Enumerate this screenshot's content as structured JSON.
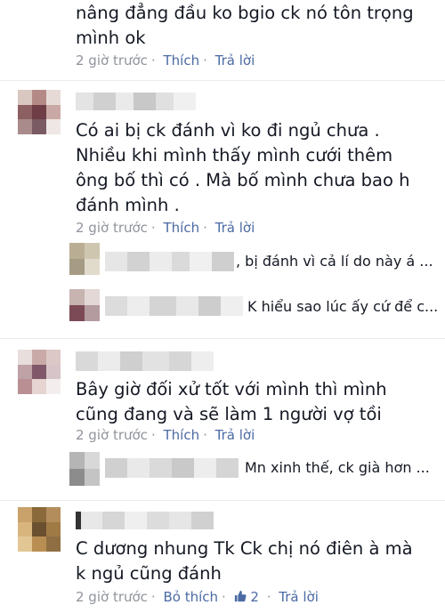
{
  "comments": [
    {
      "text": "nâng đẳng đầu ko bgio ck nó tôn trọng\nmình ok",
      "time": "2 giờ trước",
      "like": "Thích",
      "reply": "Trả lời"
    },
    {
      "text": "Có ai bị ck đánh vì ko đi ngủ chưa .\nNhiều khi mình thấy mình cưới thêm\nông bố thì có . Mà bố mình chưa bao h\nđánh mình .",
      "time": "2 giờ trước",
      "like": "Thích",
      "reply": "Trả lời",
      "replies": [
        {
          "text": ", bị đánh vì cả lí do này á ..."
        },
        {
          "text": "K hiểu sao lúc ấy cứ để c..."
        }
      ]
    },
    {
      "text": "Bây giờ đối xử tốt với mình thì mình\ncũng đang và sẽ làm 1 người vợ tồi",
      "time": "2 giờ trước",
      "like": "Thích",
      "reply": "Trả lời",
      "replies": [
        {
          "text": "Mn xinh thế, ck già hơn ..."
        }
      ]
    },
    {
      "text": "C dương nhung Tk Ck chị nó điên à mà\nk ngủ cũng đánh",
      "time": "2 giờ trước",
      "like": "Bỏ thích",
      "like_count": "2",
      "reply": "Trả lời"
    }
  ],
  "icons": {
    "like_count_icon": "thumbs-up-icon"
  },
  "colors": {
    "link": "#4b6aa3",
    "meta": "#90949c",
    "text": "#141823"
  }
}
